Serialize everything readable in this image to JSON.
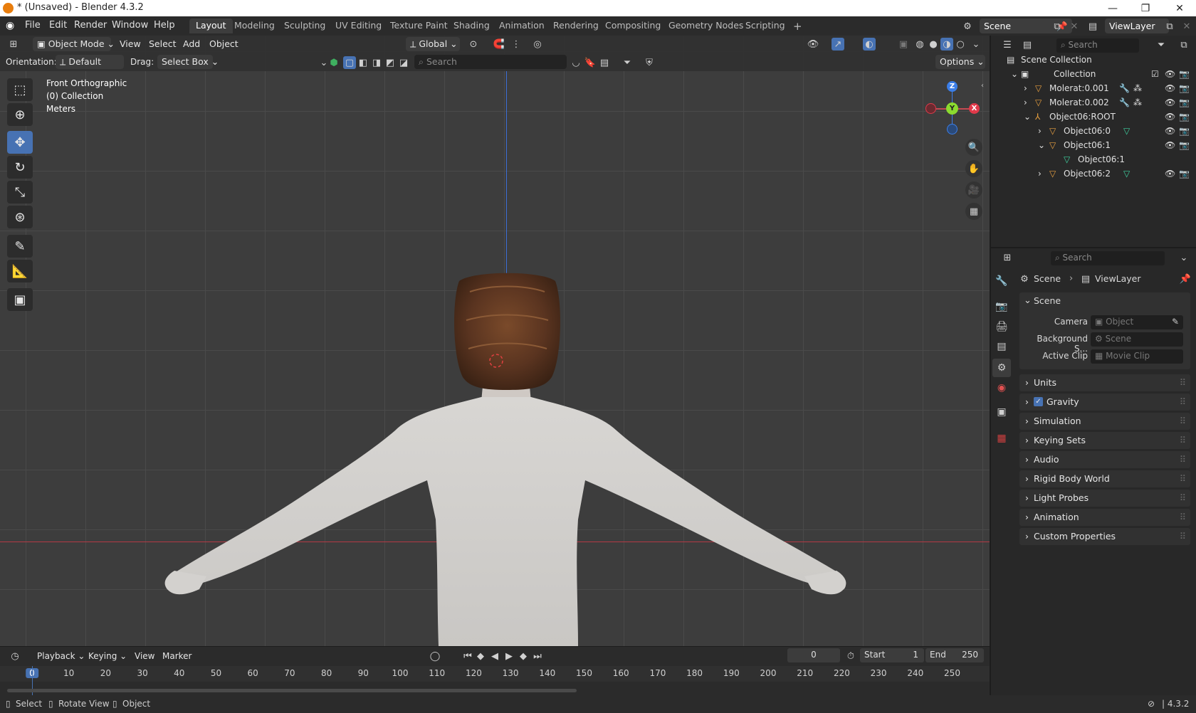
{
  "window": {
    "title": "* (Unsaved) - Blender 4.3.2"
  },
  "menus": [
    "File",
    "Edit",
    "Render",
    "Window",
    "Help"
  ],
  "workspaces": [
    "Layout",
    "Modeling",
    "Sculpting",
    "UV Editing",
    "Texture Paint",
    "Shading",
    "Animation",
    "Rendering",
    "Compositing",
    "Geometry Nodes",
    "Scripting"
  ],
  "topright": {
    "scene": "Scene",
    "viewlayer": "ViewLayer"
  },
  "viewport": {
    "mode": "Object Mode",
    "menus": [
      "View",
      "Select",
      "Add",
      "Object"
    ],
    "orientation_label": "Orientation:",
    "orientation": "Default",
    "drag_label": "Drag:",
    "drag": "Select Box",
    "transform": "Global",
    "search_placeholder": "Search",
    "options": "Options",
    "overlay_lines": [
      "Front Orthographic",
      "(0) Collection",
      "Meters"
    ]
  },
  "outliner": {
    "search_placeholder": "Search",
    "rows": [
      "Scene Collection",
      "Collection",
      "Molerat:0.001",
      "Molerat:0.002",
      "Object06:ROOT",
      "Object06:0",
      "Object06:1",
      "Object06:1",
      "Object06:2"
    ]
  },
  "properties": {
    "search_placeholder": "Search",
    "breadcrumb": [
      "Scene",
      "ViewLayer"
    ],
    "section": "Scene",
    "fields": [
      {
        "label": "Camera",
        "placeholder": "Object"
      },
      {
        "label": "Background S...",
        "placeholder": "Scene"
      },
      {
        "label": "Active Clip",
        "placeholder": "Movie Clip"
      }
    ],
    "panels": [
      "Units",
      "Gravity",
      "Simulation",
      "Keying Sets",
      "Audio",
      "Rigid Body World",
      "Light Probes",
      "Animation",
      "Custom Properties"
    ],
    "gravity_checked": true
  },
  "timeline": {
    "menus": [
      "Playback",
      "Keying",
      "View",
      "Marker"
    ],
    "current_frame": "0",
    "start_label": "Start",
    "start": "1",
    "end_label": "End",
    "end": "250",
    "ticks": [
      "0",
      "10",
      "20",
      "30",
      "40",
      "50",
      "60",
      "70",
      "80",
      "90",
      "100",
      "110",
      "120",
      "130",
      "140",
      "150",
      "160",
      "170",
      "180",
      "190",
      "200",
      "210",
      "220",
      "230",
      "240",
      "250"
    ]
  },
  "statusbar": {
    "items": [
      "Select",
      "Rotate View",
      "Object"
    ],
    "version": "4.3.2"
  },
  "colors": {
    "accent": "#4772b3",
    "axis_x": "#e0394a",
    "axis_y": "#8bdb2f",
    "axis_z": "#3b7ee8"
  }
}
